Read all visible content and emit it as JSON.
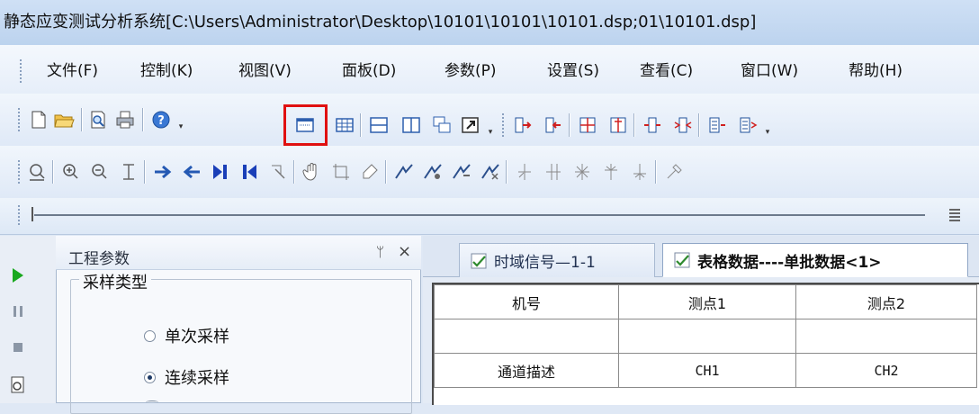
{
  "window": {
    "title": "静态应变测试分析系统[C:\\Users\\Administrator\\Desktop\\10101\\10101\\10101.dsp;01\\10101.dsp]"
  },
  "menu": {
    "items": [
      {
        "label": "文件(F)"
      },
      {
        "label": "控制(K)"
      },
      {
        "label": "视图(V)"
      },
      {
        "label": "面板(D)"
      },
      {
        "label": "参数(P)"
      },
      {
        "label": "设置(S)"
      },
      {
        "label": "查看(C)"
      },
      {
        "label": "窗口(W)"
      },
      {
        "label": "帮助(H)"
      }
    ]
  },
  "toolbar": {
    "highlight_color": "#e01010",
    "icons_row1": [
      "new-doc-icon",
      "open-folder-icon",
      "print-preview-icon",
      "print-icon",
      "help-icon",
      "table-view-icon",
      "grid-view-icon",
      "horizontal-split-icon",
      "vertical-split-icon",
      "cascade-windows-icon",
      "export-icon",
      "channel-config-1-icon",
      "channel-config-2-icon",
      "channel-config-3-icon",
      "channel-config-4-icon",
      "channel-config-5-icon",
      "channel-config-6-icon",
      "channel-config-7-icon",
      "channel-config-8-icon"
    ],
    "icons_row2": [
      "zoom-region-icon",
      "zoom-in-icon",
      "zoom-out-icon",
      "cursor-line-icon",
      "arrow-right-icon",
      "arrow-left-icon",
      "jump-end-icon",
      "jump-start-icon",
      "select-icon",
      "pan-hand-icon",
      "crop-icon",
      "brush-icon",
      "curve-1-icon",
      "curve-2-icon",
      "curve-3-icon",
      "curve-4-icon",
      "filter-1-icon",
      "filter-2-icon",
      "filter-3-icon",
      "filter-4-icon",
      "filter-5-icon",
      "tool-icon"
    ]
  },
  "left_panel": {
    "title": "工程参数",
    "pin_glyph": "ᛘ",
    "close_glyph": "×",
    "group_label": "采样类型",
    "options": [
      {
        "label": "单次采样",
        "checked": false
      },
      {
        "label": "连续采样",
        "checked": true
      }
    ]
  },
  "tabs": [
    {
      "label": "时域信号—1-1"
    },
    {
      "label": "表格数据----单批数据<1>"
    }
  ],
  "table": {
    "headers": [
      "机号",
      "测点1",
      "测点2"
    ],
    "rows": [
      [
        "",
        "",
        ""
      ],
      [
        "通道描述",
        "CH1",
        "CH2"
      ]
    ]
  }
}
